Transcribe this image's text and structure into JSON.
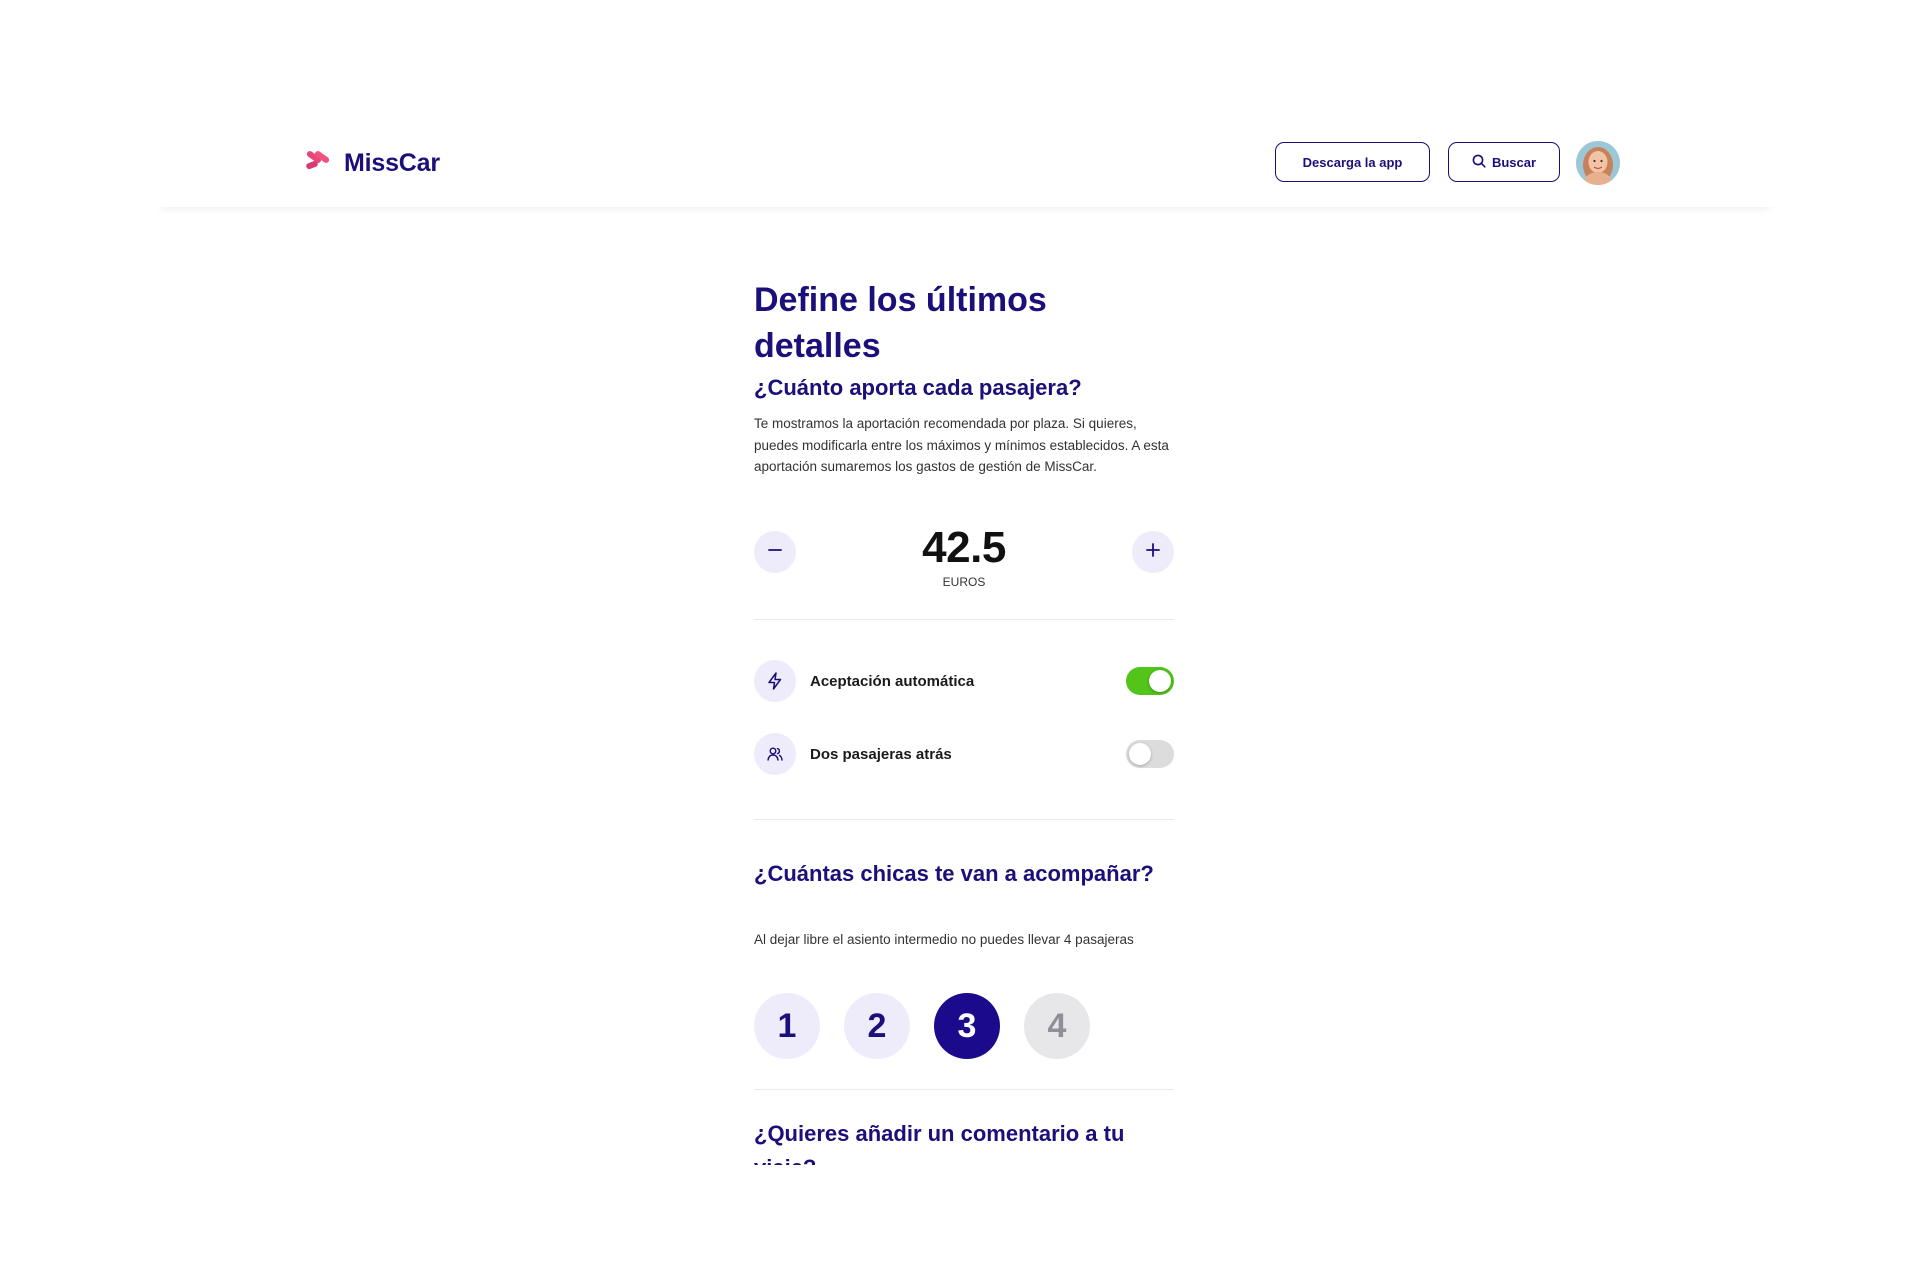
{
  "header": {
    "logo_text": "MissCar",
    "download_label": "Descarga la app",
    "search_label": "Buscar"
  },
  "main": {
    "title": "Define los últimos detalles",
    "contribution": {
      "heading": "¿Cuánto aporta cada pasajera?",
      "description": "Te mostramos la aportación recomendada por plaza. Si quieres, puedes modificarla entre los máximos y mínimos establecidos. A esta aportación sumaremos los gastos de gestión de MissCar.",
      "amount": "42.5",
      "unit": "EUROS"
    },
    "options": [
      {
        "label": "Aceptación automática",
        "enabled": true,
        "icon": "lightning-icon"
      },
      {
        "label": "Dos pasajeras atrás",
        "enabled": false,
        "icon": "people-icon"
      }
    ],
    "passengers": {
      "heading": "¿Cuántas chicas te van a acompañar?",
      "note": "Al dejar libre el asiento intermedio no puedes llevar 4 pasajeras",
      "seats": [
        "1",
        "2",
        "3",
        "4"
      ],
      "selected": "3",
      "disabled": [
        "4"
      ]
    },
    "comment": {
      "heading": "¿Quieres añadir un comentario a tu viaje?"
    }
  },
  "colors": {
    "brand": "#1b0f7a",
    "accent_pink": "#e9457d",
    "toggle_on": "#52c41a",
    "soft_purple": "#eeebfb"
  }
}
